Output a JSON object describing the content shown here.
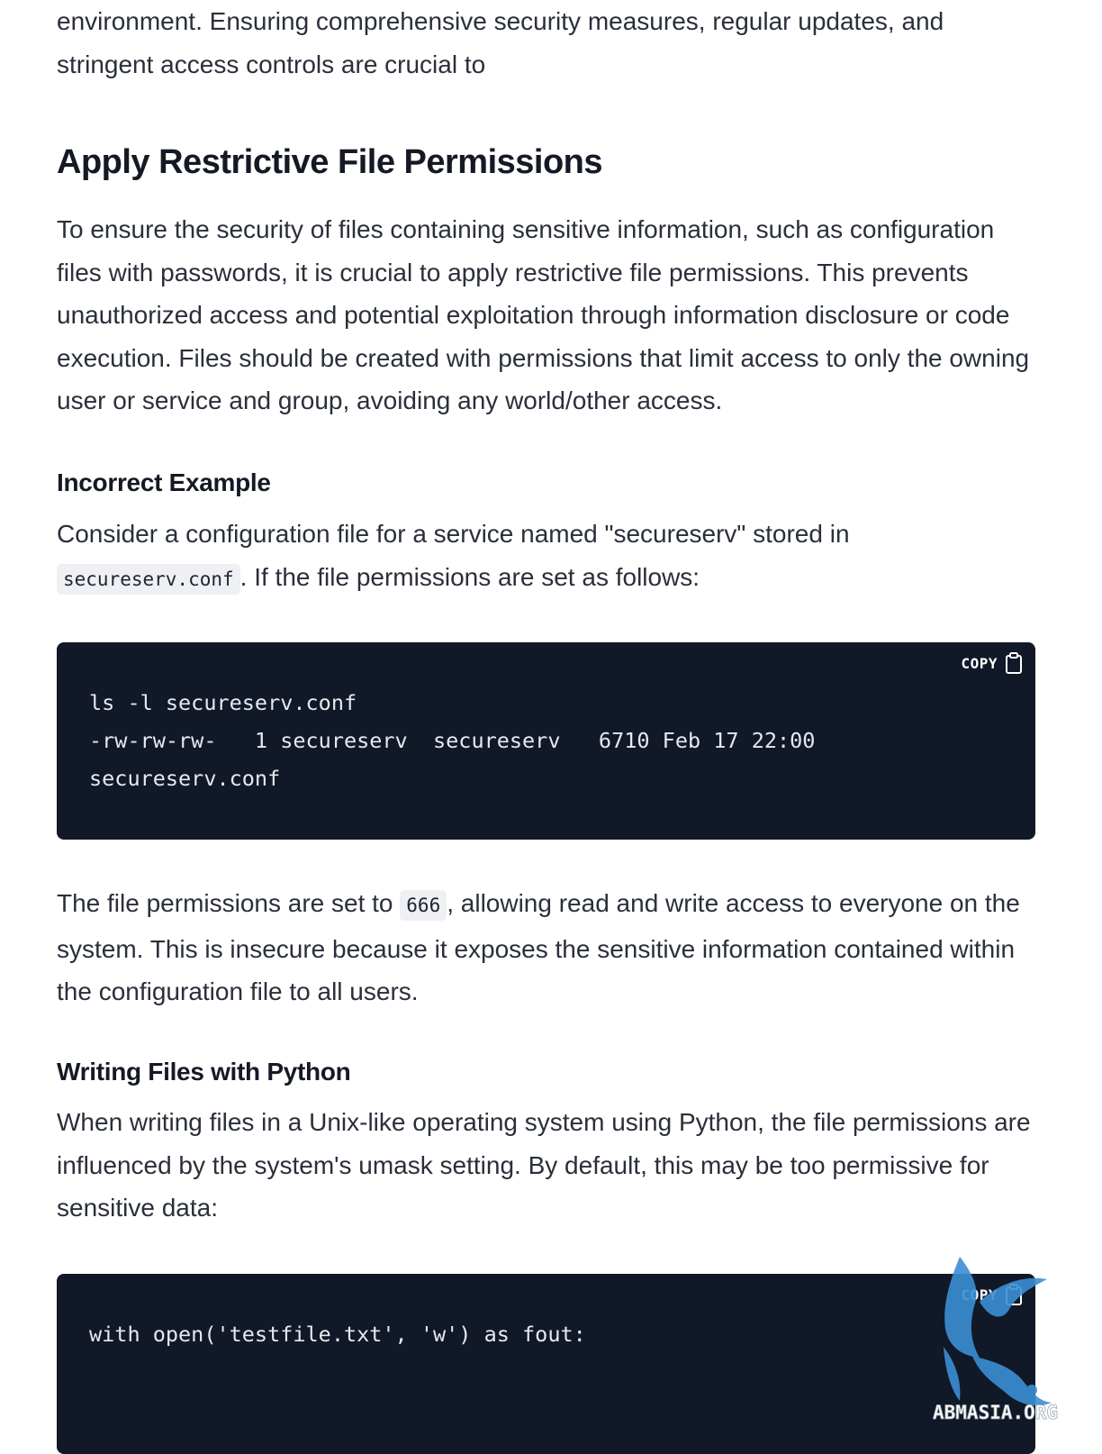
{
  "intro": {
    "text": "environment. Ensuring comprehensive security measures, regular updates, and stringent access controls are crucial to"
  },
  "section": {
    "title": "Apply Restrictive File Permissions",
    "intro_paragraph": "To ensure the security of files containing sensitive information, such as configuration files with passwords, it is crucial to apply restrictive file permissions. This prevents unauthorized access and potential exploitation through information disclosure or code execution. Files should be created with permissions that limit access to only the owning user or service and group, avoiding any world/other access."
  },
  "incorrect_example": {
    "heading": "Incorrect Example",
    "para_before": "Consider a configuration file for a service named \"secureserv\" stored in",
    "inline_code": "secureserv.conf",
    "para_after": ". If the file permissions are set as follows:",
    "code": "ls -l secureserv.conf\n-rw-rw-rw-   1 secureserv  secureserv   6710 Feb 17 22:00\nsecureserv.conf",
    "explain_before": "The file permissions are set to",
    "explain_code": "666",
    "explain_after": ", allowing read and write access to everyone on the system. This is insecure because it exposes the sensitive information contained within the configuration file to all users."
  },
  "python_section": {
    "heading": "Writing Files with Python",
    "paragraph": "When writing files in a Unix-like operating system using Python, the file permissions are influenced by the system's umask setting. By default, this may be too permissive for sensitive data:",
    "code": "with open('testfile.txt', 'w') as fout:"
  },
  "copy_button": {
    "label": "COPY",
    "icon": "clipboard-icon"
  },
  "watermark": {
    "text": "ABMASIA.ORG",
    "color": "#3b8fd4"
  },
  "colors": {
    "code_background": "#111827",
    "inline_code_background": "#eef0f3",
    "heading": "#151925",
    "body_text": "#2a2f3a"
  }
}
